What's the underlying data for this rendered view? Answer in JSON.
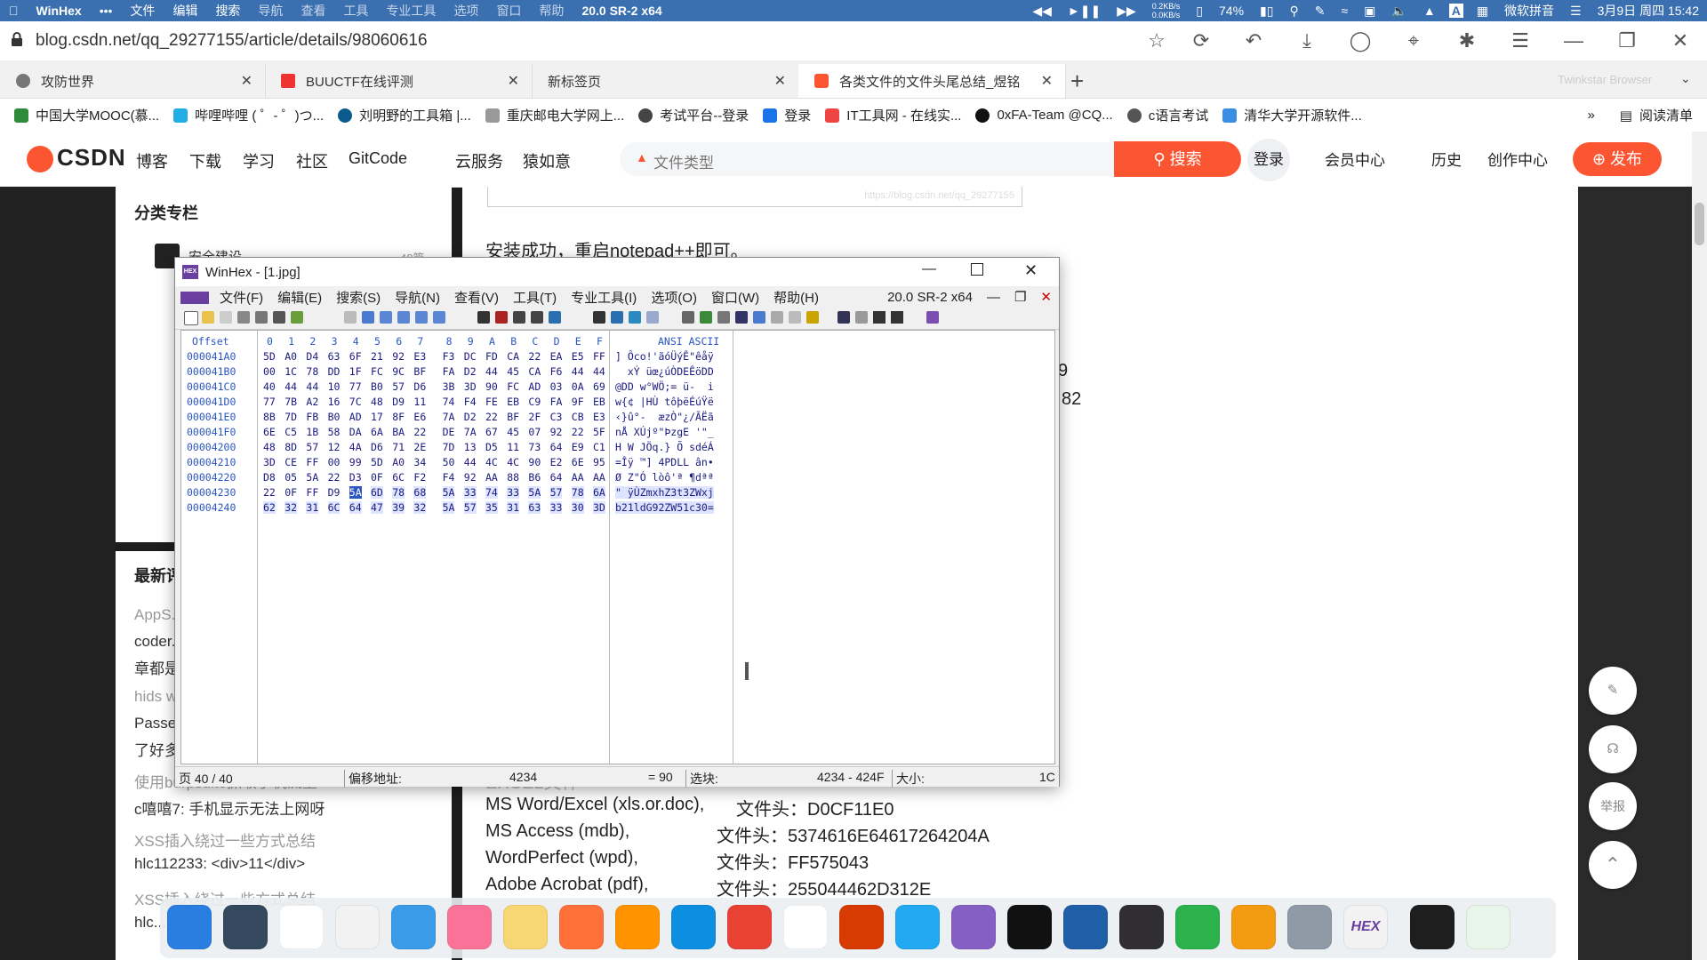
{
  "macbar": {
    "app": "WinHex",
    "dots": "•••",
    "menus": [
      "文件",
      "编辑",
      "搜索",
      "导航",
      "查看",
      "工具",
      "专业工具",
      "选项",
      "窗口",
      "帮助",
      "20.0 SR-2 x64"
    ],
    "net_up": "0.2KB/s",
    "net_down": "0.0KB/s",
    "battery": "74%",
    "ime": "微软拼音",
    "datetime": "3月9日 周四 15:42"
  },
  "browser": {
    "url": "blog.csdn.net/qq_29277155/article/details/98060616",
    "brand": "Twinkstar Browser",
    "tabs": [
      {
        "label": "攻防世界",
        "color": "#777"
      },
      {
        "label": "BUUCTF在线评测",
        "color": "#e33"
      },
      {
        "label": "新标签页",
        "color": ""
      },
      {
        "label": "各类文件的文件头尾总结_煜铭",
        "color": "#fc5531"
      }
    ],
    "new_tab": "+",
    "bookmarks": [
      {
        "label": "中国大学MOOC(慕...",
        "color": "#2f8a3a"
      },
      {
        "label": "哔哩哔哩 ( ゜- ゜)つ...",
        "color": "#23ade5"
      },
      {
        "label": "刘明野的工具箱 |...",
        "color": "#0b5a8c"
      },
      {
        "label": "重庆邮电大学网上...",
        "color": "#999"
      },
      {
        "label": "考试平台--登录",
        "color": "#444"
      },
      {
        "label": "登录",
        "color": "#1a73e8"
      },
      {
        "label": "IT工具网 - 在线实...",
        "color": "#e44"
      },
      {
        "label": "0xFA-Team @CQ...",
        "color": "#111"
      },
      {
        "label": "c语言考试",
        "color": "#555"
      },
      {
        "label": "清华大学开源软件...",
        "color": "#3a8ee6"
      }
    ],
    "reading_list": "阅读清单"
  },
  "csdn": {
    "logo": "CSDN",
    "nav": [
      "博客",
      "下载",
      "学习",
      "社区",
      "GitCode",
      "云服务",
      "猿如意"
    ],
    "search_placeholder": "文件类型",
    "search_button": "搜索",
    "login": "登录",
    "vip": "会员中心",
    "history": "历史",
    "create": "创作中心",
    "publish": "发布"
  },
  "sidebar": {
    "category_title": "分类专栏",
    "category_first": "安全建设",
    "category_first_count": "48篇",
    "recent_title": "最新评论",
    "recent": [
      "AppS...",
      "coder...",
      "章都是...",
      "hids w...",
      "Passe...",
      "了好多...",
      "使用burpsuite抓取手机流量",
      "c嘻嘻7: 手机显示无法上网呀",
      "XSS插入绕过一些方式总结",
      "hlc112233: <div>11</div>",
      "XSS插入绕过一些方式总结",
      "hlc..."
    ]
  },
  "article": {
    "watermark": "https://blog.csdn.net/qq_29277155",
    "line1": "安装成功，重启notepad++即可。",
    "frag1": "9",
    "frag2": "82",
    "partial": "EXCEL文件",
    "rows": [
      {
        "name": "MS Word/Excel (xls.or.doc),",
        "head": "文件头：D0CF11E0"
      },
      {
        "name": "MS Access (mdb),",
        "head": "文件头：5374616E64617264204A"
      },
      {
        "name": "WordPerfect (wpd),",
        "head": "文件头：FF575043"
      },
      {
        "name": "Adobe Acrobat (pdf),",
        "head": "文件头：255044462D312E"
      }
    ]
  },
  "float_buttons": {
    "report": "举报"
  },
  "winhex": {
    "title": "WinHex - [1.jpg]",
    "menus": [
      "文件(F)",
      "编辑(E)",
      "搜索(S)",
      "导航(N)",
      "查看(V)",
      "工具(T)",
      "专业工具(I)",
      "选项(O)",
      "窗口(W)",
      "帮助(H)"
    ],
    "version": "20.0 SR-2 x64",
    "header_offset": "Offset",
    "header_cols": [
      "0",
      "1",
      "2",
      "3",
      "4",
      "5",
      "6",
      "7",
      "8",
      "9",
      "A",
      "B",
      "C",
      "D",
      "E",
      "F"
    ],
    "header_ascii": "ANSI ASCII",
    "rows": [
      {
        "off": "000041A0",
        "hex": [
          "5D",
          "A0",
          "D4",
          "63",
          "6F",
          "21",
          "92",
          "E3",
          "F3",
          "DC",
          "FD",
          "CA",
          "22",
          "EA",
          "E5",
          "FF"
        ],
        "ascii": "] Ôco!'ãóÜýÊ\"êåÿ"
      },
      {
        "off": "000041B0",
        "hex": [
          "00",
          "1C",
          "78",
          "DD",
          "1F",
          "FC",
          "9C",
          "BF",
          "FA",
          "D2",
          "44",
          "45",
          "CA",
          "F6",
          "44",
          "44"
        ],
        "ascii": "  xÝ üœ¿úÒDEÊöDD"
      },
      {
        "off": "000041C0",
        "hex": [
          "40",
          "44",
          "44",
          "10",
          "77",
          "B0",
          "57",
          "D6",
          "3B",
          "3D",
          "90",
          "FC",
          "AD",
          "03",
          "0A",
          "69"
        ],
        "ascii": "@DD w°WÖ;= ü-  i"
      },
      {
        "off": "000041D0",
        "hex": [
          "77",
          "7B",
          "A2",
          "16",
          "7C",
          "48",
          "D9",
          "11",
          "74",
          "F4",
          "FE",
          "EB",
          "C9",
          "FA",
          "9F",
          "EB"
        ],
        "ascii": "w{¢ |HÙ tôþëÉúŸë"
      },
      {
        "off": "000041E0",
        "hex": [
          "8B",
          "7D",
          "FB",
          "B0",
          "AD",
          "17",
          "8F",
          "E6",
          "7A",
          "D2",
          "22",
          "BF",
          "2F",
          "C3",
          "CB",
          "E3"
        ],
        "ascii": "‹}û°-  æzÒ\"¿/ÃËã"
      },
      {
        "off": "000041F0",
        "hex": [
          "6E",
          "C5",
          "1B",
          "58",
          "DA",
          "6A",
          "BA",
          "22",
          "DE",
          "7A",
          "67",
          "45",
          "07",
          "92",
          "22",
          "5F"
        ],
        "ascii": "nÅ XÚjº\"ÞzgE '\"_"
      },
      {
        "off": "00004200",
        "hex": [
          "48",
          "8D",
          "57",
          "12",
          "4A",
          "D6",
          "71",
          "2E",
          "7D",
          "13",
          "D5",
          "11",
          "73",
          "64",
          "E9",
          "C1"
        ],
        "ascii": "H W JÖq.} Õ sdéÁ"
      },
      {
        "off": "00004210",
        "hex": [
          "3D",
          "CE",
          "FF",
          "00",
          "99",
          "5D",
          "A0",
          "34",
          "50",
          "44",
          "4C",
          "4C",
          "90",
          "E2",
          "6E",
          "95"
        ],
        "ascii": "=Îÿ ™] 4PDLL ân•"
      },
      {
        "off": "00004220",
        "hex": [
          "D8",
          "05",
          "5A",
          "22",
          "D3",
          "0F",
          "6C",
          "F2",
          "F4",
          "92",
          "AA",
          "88",
          "B6",
          "64",
          "AA",
          "AA"
        ],
        "ascii": "Ø Z\"Ó lòô'ª ¶dªª"
      },
      {
        "off": "00004230",
        "hex": [
          "22",
          "0F",
          "FF",
          "D9",
          "5A",
          "6D",
          "78",
          "68",
          "5A",
          "33",
          "74",
          "33",
          "5A",
          "57",
          "78",
          "6A"
        ],
        "ascii": "\" ÿÙZmxhZ3t3ZWxj"
      },
      {
        "off": "00004240",
        "hex": [
          "62",
          "32",
          "31",
          "6C",
          "64",
          "47",
          "39",
          "32",
          "5A",
          "57",
          "35",
          "31",
          "63",
          "33",
          "30",
          "3D"
        ],
        "ascii": "b21ldG92ZW51c30="
      }
    ],
    "status": {
      "page": "页 40 / 40",
      "offset_label": "偏移地址:",
      "offset": "4234",
      "value": "= 90",
      "sel_label": "选块:",
      "sel": "4234 - 424F",
      "size_label": "大小:",
      "size": "1C"
    }
  },
  "dock": [
    {
      "name": "finder",
      "color": "#2a7de1"
    },
    {
      "name": "launchpad",
      "color": "#34495e"
    },
    {
      "name": "qq",
      "color": "#ffffff"
    },
    {
      "name": "wechat",
      "color": "#f2f2f2"
    },
    {
      "name": "qq-browser",
      "color": "#3a9be9"
    },
    {
      "name": "bilibili",
      "color": "#fb7299"
    },
    {
      "name": "notes-star",
      "color": "#f7d774"
    },
    {
      "name": "firefox",
      "color": "#ff7139"
    },
    {
      "name": "firefox-dev",
      "color": "#ff9400"
    },
    {
      "name": "edge",
      "color": "#0c8fe0"
    },
    {
      "name": "chrome",
      "color": "#e94235"
    },
    {
      "name": "typora",
      "color": "#ffffff"
    },
    {
      "name": "office",
      "color": "#d83b01"
    },
    {
      "name": "vscode",
      "color": "#23a9f2"
    },
    {
      "name": "visual-studio",
      "color": "#865fc5"
    },
    {
      "name": "intellij",
      "color": "#111111"
    },
    {
      "name": "virtual-box",
      "color": "#1e5fa8"
    },
    {
      "name": "obs",
      "color": "#302e31"
    },
    {
      "name": "music",
      "color": "#2bb24c"
    },
    {
      "name": "everything-search",
      "color": "#f39c12"
    },
    {
      "name": "settings",
      "color": "#8e9aa6"
    },
    {
      "name": "winhex",
      "color": "#f2f2f2"
    },
    {
      "name": "terminal",
      "color": "#1e1e1e"
    },
    {
      "name": "recycle-bin",
      "color": "#e8f5e9"
    }
  ],
  "dock_winhex_label": "HEX"
}
